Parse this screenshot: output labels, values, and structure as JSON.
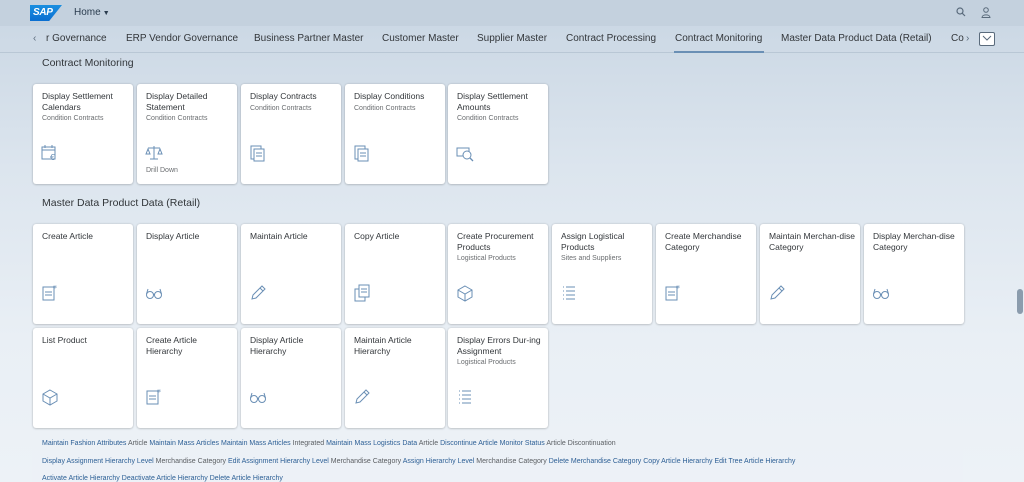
{
  "shell": {
    "logo": "SAP",
    "home_label": "Home",
    "icons": [
      "search-icon",
      "user-icon"
    ]
  },
  "tabs": [
    {
      "label": "r Governance"
    },
    {
      "label": "ERP Vendor Governance"
    },
    {
      "label": "Business Partner Master"
    },
    {
      "label": "Customer Master"
    },
    {
      "label": "Supplier Master"
    },
    {
      "label": "Contract Processing"
    },
    {
      "label": "Contract Monitoring",
      "active": true
    },
    {
      "label": "Master Data Product Data (Retail)"
    },
    {
      "label": "Co"
    }
  ],
  "groups": {
    "contract_monitoring": {
      "title": "Contract Monitoring",
      "tiles": [
        {
          "title": "Display Settlement Calendars",
          "subtitle": "Condition Contracts",
          "footer": "",
          "icon": "calendar-euro-icon"
        },
        {
          "title": "Display Detailed Statement",
          "subtitle": "Condition Contracts",
          "footer": "Drill Down",
          "icon": "balance-scale-icon"
        },
        {
          "title": "Display Contracts",
          "subtitle": "Condition Contracts",
          "footer": "",
          "icon": "documents-icon"
        },
        {
          "title": "Display Conditions",
          "subtitle": "Condition Contracts",
          "footer": "",
          "icon": "documents-icon"
        },
        {
          "title": "Display Settlement Amounts",
          "subtitle": "Condition Contracts",
          "footer": "",
          "icon": "money-search-icon"
        }
      ]
    },
    "master_data": {
      "title": "Master Data Product Data (Retail)",
      "tiles_row1": [
        {
          "title": "Create Article",
          "subtitle": "",
          "icon": "create-document-icon"
        },
        {
          "title": "Display Article",
          "subtitle": "",
          "icon": "glasses-icon"
        },
        {
          "title": "Maintain Article",
          "subtitle": "",
          "icon": "pencil-icon"
        },
        {
          "title": "Copy Article",
          "subtitle": "",
          "icon": "copy-icon"
        },
        {
          "title": "Create Procurement Products",
          "subtitle": "Logistical Products",
          "icon": "product-icon"
        },
        {
          "title": "Assign Logistical Products",
          "subtitle": "Sites and Suppliers",
          "icon": "list-icon"
        },
        {
          "title": "Create Merchandise Category",
          "subtitle": "",
          "icon": "create-document-icon"
        },
        {
          "title": "Maintain Merchan-dise Category",
          "subtitle": "",
          "icon": "pencil-icon"
        },
        {
          "title": "Display Merchan-dise Category",
          "subtitle": "",
          "icon": "glasses-icon"
        }
      ],
      "tiles_row2": [
        {
          "title": "List Product",
          "subtitle": "",
          "icon": "product-icon"
        },
        {
          "title": "Create Article Hierarchy",
          "subtitle": "",
          "icon": "create-document-icon"
        },
        {
          "title": "Display Article Hierarchy",
          "subtitle": "",
          "icon": "glasses-icon"
        },
        {
          "title": "Maintain Article Hierarchy",
          "subtitle": "",
          "icon": "pencil-icon"
        },
        {
          "title": "Display Errors Dur-ing Assignment",
          "subtitle": "Logistical Products",
          "icon": "list-icon"
        }
      ]
    }
  },
  "links": {
    "row1": [
      {
        "link": "Maintain Fashion Attributes",
        "sub": "Article"
      },
      {
        "link": "Maintain Mass Articles",
        "sub": ""
      },
      {
        "link": "Maintain Mass Articles",
        "sub": "Integrated"
      },
      {
        "link": "Maintain Mass Logistics Data",
        "sub": "Article"
      },
      {
        "link": "Discontinue Article",
        "sub": ""
      },
      {
        "link": "Monitor Status",
        "sub": "Article Discontinuation"
      }
    ],
    "row2": [
      {
        "link": "Display Assignment Hierarchy Level",
        "sub": "Merchandise Category"
      },
      {
        "link": "Edit Assignment Hierarchy Level",
        "sub": "Merchandise Category"
      },
      {
        "link": "Assign Hierarchy Level",
        "sub": "Merchandise Category"
      },
      {
        "link": "Delete Merchandise Category",
        "sub": ""
      },
      {
        "link": "Copy Article Hierarchy",
        "sub": ""
      },
      {
        "link": "Edit Tree Article Hierarchy",
        "sub": ""
      }
    ],
    "row3": [
      {
        "link": "Activate Article Hierarchy",
        "sub": ""
      },
      {
        "link": "Deactivate Article Hierarchy",
        "sub": ""
      },
      {
        "link": "Delete Article Hierarchy",
        "sub": ""
      }
    ]
  },
  "colors": {
    "link": "#2c5f95",
    "icon": "#6a8fb5",
    "brand": "#0a6ed1"
  }
}
